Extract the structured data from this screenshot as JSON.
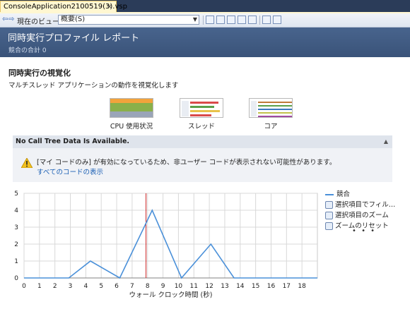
{
  "tab": {
    "title": "ConsoleApplication2100519(3).vsp",
    "close": "×"
  },
  "toolbar": {
    "back": "⇦",
    "forward": "⇨",
    "view_label": "現在のビュー:",
    "view_value": "概要(S)",
    "icons": [
      "save-report-icon",
      "export-icon",
      "compare-icon",
      "filter-icon",
      "marks-icon",
      "settings-icon",
      "tools-icon"
    ]
  },
  "header": {
    "title": "同時実行プロファイル レポート",
    "subtitle": "競合の合計 0"
  },
  "section": {
    "title": "同時実行の視覚化",
    "description": "マルチスレッド アプリケーションの動作を視覚化します",
    "visualizations": [
      {
        "label": "CPU 使用状況"
      },
      {
        "label": "スレッド"
      },
      {
        "label": "コア"
      }
    ]
  },
  "info": {
    "heading": "No Call Tree Data Is Available.",
    "message": "[マイ コードのみ] が有効になっているため、非ユーザー コードが表示されない可能性があります。",
    "link": "すべてのコードの表示"
  },
  "legend": {
    "series": "競合"
  },
  "actions": {
    "filter": "選択項目でフィル…",
    "zoom": "選択項目のズーム",
    "reset": "ズームのリセット",
    "more": "• • •"
  },
  "chart_data": {
    "type": "line",
    "xlabel": "ウォール クロック時間 (秒)",
    "ylabel": "",
    "xlim": [
      0,
      19
    ],
    "ylim": [
      0,
      5
    ],
    "xticks": [
      0,
      1,
      2,
      3,
      4,
      5,
      6,
      7,
      8,
      9,
      10,
      11,
      12,
      13,
      14,
      15,
      16,
      17,
      18
    ],
    "yticks": [
      0,
      1,
      2,
      3,
      4,
      5
    ],
    "series": [
      {
        "name": "競合",
        "x": [
          0,
          2.9,
          4.3,
          6.2,
          8.3,
          10.2,
          12.1,
          13.6,
          19
        ],
        "y": [
          0,
          0,
          1,
          0,
          4,
          0,
          2,
          0,
          0
        ]
      }
    ],
    "marker_x": 7.9,
    "colors": {
      "line": "#4a90d9",
      "marker": "#cc2222",
      "grid": "#d8d8d8"
    }
  }
}
